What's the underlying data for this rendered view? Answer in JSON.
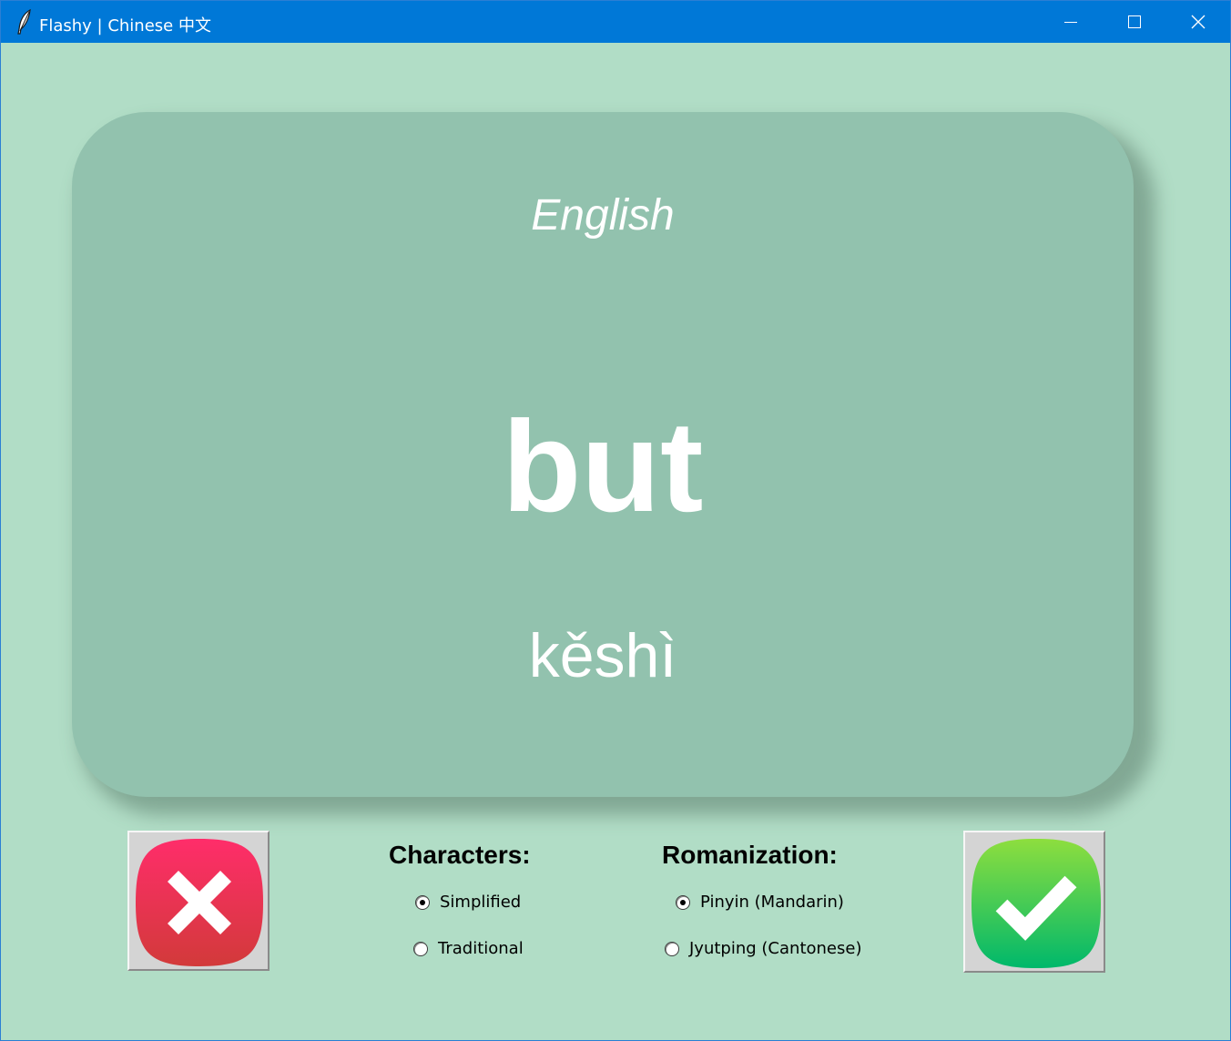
{
  "window": {
    "title": "Flashy | Chinese 中文",
    "background_color": "#b1ddc6",
    "titlebar_color": "#0078d7",
    "icons": [
      "feather-icon",
      "minimize-icon",
      "maximize-icon",
      "close-icon"
    ]
  },
  "card": {
    "language": "English",
    "word": "but",
    "romanization": "kěshì",
    "color": "#92c2ae"
  },
  "buttons": {
    "wrong_icon": "x-icon",
    "right_icon": "checkmark-icon",
    "wrong_color": "#e8334f",
    "right_color": "#19c35e"
  },
  "options": {
    "characters": {
      "label": "Characters:",
      "choices": [
        "Simplified",
        "Traditional"
      ],
      "selected": "Simplified"
    },
    "romanization": {
      "label": "Romanization:",
      "choices": [
        "Pinyin (Mandarin)",
        "Jyutping (Cantonese)"
      ],
      "selected": "Pinyin (Mandarin)"
    }
  }
}
